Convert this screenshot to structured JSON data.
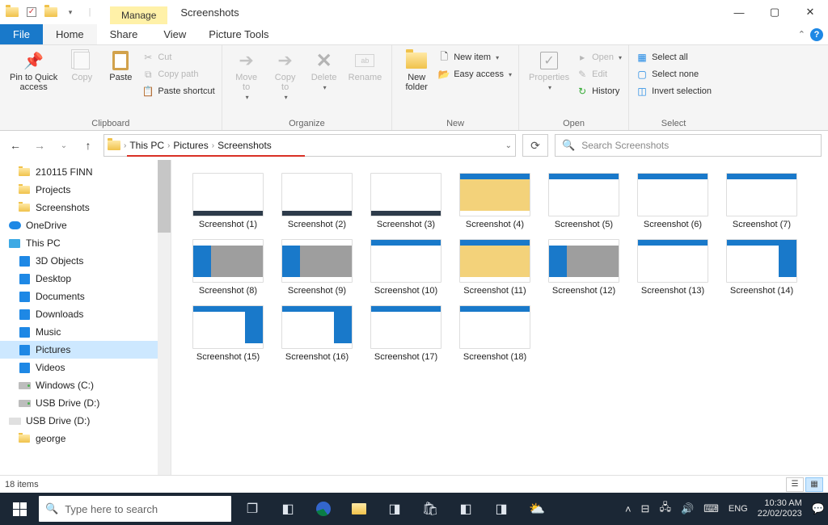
{
  "window": {
    "contextual_tab": "Manage",
    "title": "Screenshots",
    "tools_label": "Picture Tools"
  },
  "tabs": {
    "file": "File",
    "home": "Home",
    "share": "Share",
    "view": "View"
  },
  "ribbon": {
    "clipboard": {
      "label": "Clipboard",
      "pin": "Pin to Quick\naccess",
      "copy": "Copy",
      "paste": "Paste",
      "cut": "Cut",
      "copy_path": "Copy path",
      "paste_shortcut": "Paste shortcut"
    },
    "organize": {
      "label": "Organize",
      "move": "Move\nto",
      "copy_to": "Copy\nto",
      "delete": "Delete",
      "rename": "Rename"
    },
    "new": {
      "label": "New",
      "new_folder": "New\nfolder",
      "new_item": "New item",
      "easy_access": "Easy access"
    },
    "open": {
      "label": "Open",
      "properties": "Properties",
      "open": "Open",
      "edit": "Edit",
      "history": "History"
    },
    "select": {
      "label": "Select",
      "all": "Select all",
      "none": "Select none",
      "invert": "Invert selection"
    }
  },
  "breadcrumb": {
    "root": "This PC",
    "l1": "Pictures",
    "l2": "Screenshots"
  },
  "search": {
    "placeholder": "Search Screenshots"
  },
  "sidebar": {
    "quick": [
      "210115 FINN",
      "Projects",
      "Screenshots"
    ],
    "onedrive": "OneDrive",
    "thispc": "This PC",
    "libs": [
      "3D Objects",
      "Desktop",
      "Documents",
      "Downloads",
      "Music",
      "Pictures",
      "Videos"
    ],
    "drives": [
      "Windows (C:)",
      "USB Drive (D:)"
    ],
    "removable": "USB Drive (D:)",
    "extra": "george"
  },
  "files": [
    "Screenshot (1)",
    "Screenshot (2)",
    "Screenshot (3)",
    "Screenshot (4)",
    "Screenshot (5)",
    "Screenshot (6)",
    "Screenshot (7)",
    "Screenshot (8)",
    "Screenshot (9)",
    "Screenshot (10)",
    "Screenshot (11)",
    "Screenshot (12)",
    "Screenshot (13)",
    "Screenshot (14)",
    "Screenshot (15)",
    "Screenshot (16)",
    "Screenshot (17)",
    "Screenshot (18)"
  ],
  "thumb_style": [
    "bot",
    "bot",
    "bot",
    "y",
    "top",
    "top",
    "top",
    "lg",
    "lg",
    "top",
    "y",
    "lg",
    "top",
    "rp",
    "rp",
    "rp",
    "top",
    "top"
  ],
  "status": {
    "count": "18 items"
  },
  "taskbar": {
    "search_placeholder": "Type here to search",
    "lang": "ENG",
    "time": "10:30 AM",
    "date": "22/02/2023"
  }
}
